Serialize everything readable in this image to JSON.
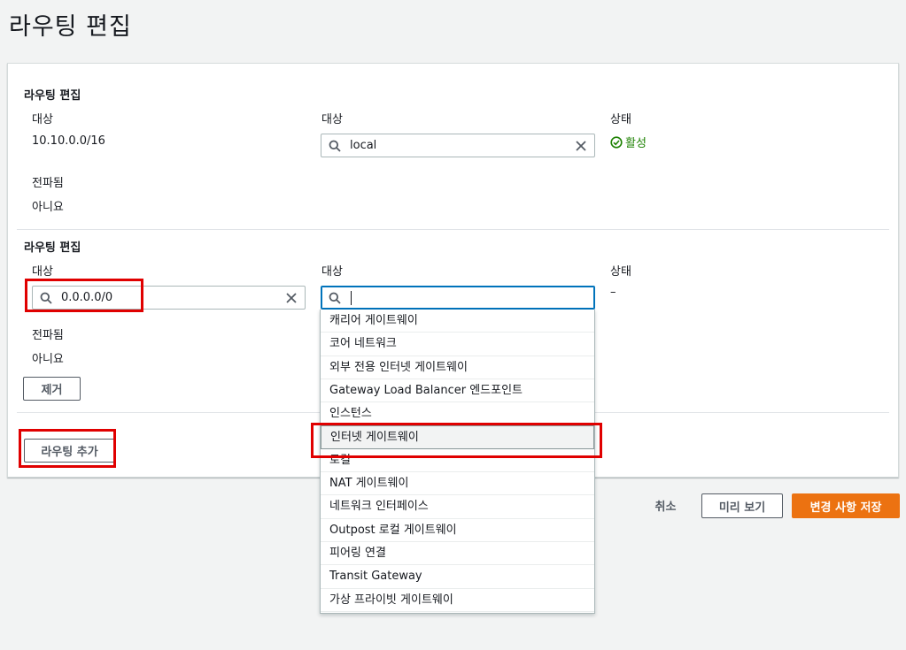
{
  "page": {
    "title": "라우팅 편집"
  },
  "route1": {
    "section_title": "라우팅 편집",
    "destination_label": "대상",
    "destination_value": "10.10.0.0/16",
    "target_label": "대상",
    "target_value": "local",
    "status_label": "상태",
    "status_value": "활성",
    "propagated_label": "전파됨",
    "propagated_value": "아니요"
  },
  "route2": {
    "section_title": "라우팅 편집",
    "destination_label": "대상",
    "destination_value": "0.0.0.0/0",
    "target_label": "대상",
    "target_value": "",
    "status_label": "상태",
    "status_value": "–",
    "propagated_label": "전파됨",
    "propagated_value": "아니요",
    "remove_button": "제거"
  },
  "add_route_button": "라우팅 추가",
  "dropdown": {
    "options": [
      "캐리어 게이트웨이",
      "코어 네트워크",
      "외부 전용 인터넷 게이트웨이",
      "Gateway Load Balancer 엔드포인트",
      "인스턴스",
      "인터넷 게이트웨이",
      "로컬",
      "NAT 게이트웨이",
      "네트워크 인터페이스",
      "Outpost 로컬 게이트웨이",
      "피어링 연결",
      "Transit Gateway",
      "가상 프라이빗 게이트웨이"
    ],
    "highlighted_index": 5
  },
  "footer": {
    "cancel": "취소",
    "preview": "미리 보기",
    "save": "변경 사항 저장"
  },
  "colors": {
    "primary": "#ec7211",
    "success": "#1d8102",
    "focus": "#0073bb",
    "highlight": "#e00000"
  }
}
